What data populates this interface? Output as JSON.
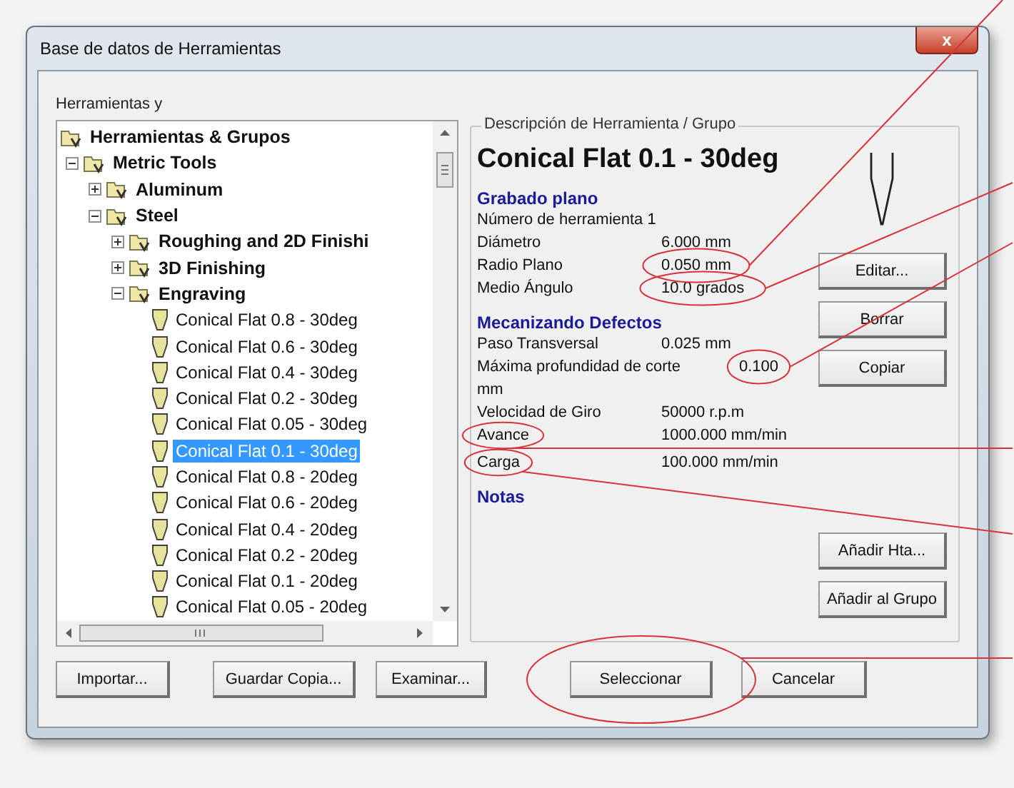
{
  "window": {
    "title": "Base de datos de Herramientas",
    "close_label": "x"
  },
  "tree_group": {
    "label": "Herramientas y",
    "root": {
      "label": "Herramientas & Grupos",
      "kind": "group",
      "children": [
        {
          "label": "Metric Tools",
          "kind": "group",
          "expanded": true,
          "children": [
            {
              "label": "Aluminum",
              "kind": "group",
              "expanded": false
            },
            {
              "label": "Steel",
              "kind": "group",
              "expanded": true,
              "children": [
                {
                  "label": "Roughing and 2D Finishi",
                  "kind": "group",
                  "expanded": false
                },
                {
                  "label": "3D Finishing",
                  "kind": "group",
                  "expanded": false
                },
                {
                  "label": "Engraving",
                  "kind": "group",
                  "expanded": true,
                  "children": [
                    {
                      "label": "Conical Flat 0.8 - 30deg",
                      "kind": "tool",
                      "selected": false
                    },
                    {
                      "label": "Conical Flat 0.6 - 30deg",
                      "kind": "tool",
                      "selected": false
                    },
                    {
                      "label": "Conical Flat 0.4 - 30deg",
                      "kind": "tool",
                      "selected": false
                    },
                    {
                      "label": "Conical Flat 0.2 - 30deg",
                      "kind": "tool",
                      "selected": false
                    },
                    {
                      "label": "Conical Flat 0.05 - 30deg",
                      "kind": "tool",
                      "selected": false
                    },
                    {
                      "label": "Conical Flat 0.1 - 30deg",
                      "kind": "tool",
                      "selected": true
                    },
                    {
                      "label": "Conical Flat 0.8 - 20deg",
                      "kind": "tool",
                      "selected": false
                    },
                    {
                      "label": "Conical Flat 0.6 - 20deg",
                      "kind": "tool",
                      "selected": false
                    },
                    {
                      "label": "Conical Flat 0.4 - 20deg",
                      "kind": "tool",
                      "selected": false
                    },
                    {
                      "label": "Conical Flat 0.2 - 20deg",
                      "kind": "tool",
                      "selected": false
                    },
                    {
                      "label": "Conical Flat 0.1 - 20deg",
                      "kind": "tool",
                      "selected": false
                    },
                    {
                      "label": "Conical Flat 0.05 - 20deg",
                      "kind": "tool",
                      "selected": false
                    }
                  ]
                }
              ]
            }
          ]
        }
      ]
    }
  },
  "details": {
    "legend": "Descripción de Herramienta / Grupo",
    "title": "Conical Flat 0.1 - 30deg",
    "sections": [
      {
        "heading": "Grabado plano",
        "lines": [
          {
            "label": "Número de herramienta 1"
          },
          {
            "label": "Diámetro",
            "value": "6.000 mm"
          },
          {
            "label": "Radio Plano",
            "value": "0.050 mm"
          },
          {
            "label": "Medio Ángulo",
            "value": "10.0 grados"
          }
        ]
      },
      {
        "heading": "Mecanizando Defectos",
        "lines": [
          {
            "label": "Paso Transversal",
            "value": "0.025 mm"
          },
          {
            "label": "Máxima profundidad de corte",
            "value": "0.100"
          },
          {
            "label": "mm"
          },
          {
            "label": "Velocidad de Giro",
            "value": "50000 r.p.m"
          },
          {
            "label": "Avance",
            "value": "1000.000 mm/min"
          },
          {
            "label": "Carga",
            "value": "100.000 mm/min"
          }
        ]
      },
      {
        "heading": "Notas"
      }
    ],
    "buttons": [
      "Editar...",
      "Borrar",
      "Copiar"
    ],
    "lower_buttons": [
      "Añadir Hta...",
      "Añadir al Grupo"
    ]
  },
  "bottom_buttons": [
    "Importar...",
    "Guardar Copia...",
    "Examinar...",
    "Seleccionar",
    "Cancelar"
  ]
}
